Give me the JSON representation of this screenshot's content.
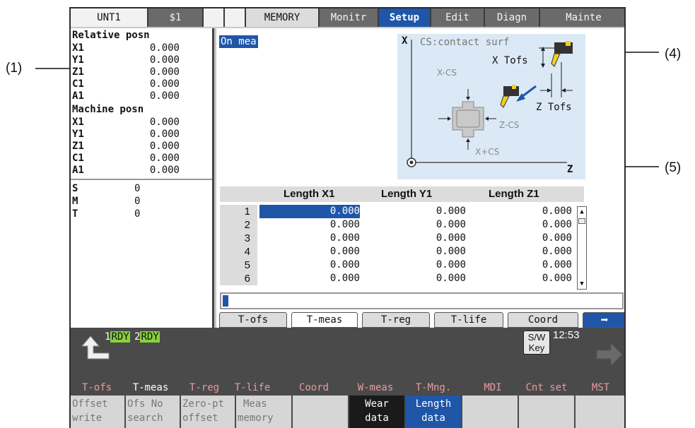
{
  "callouts": [
    "(1)",
    "(4)",
    "(5)"
  ],
  "topbar": {
    "unit": "UNT1",
    "system": "$1",
    "mode": "MEMORY",
    "tabs": [
      "Monitr",
      "Setup",
      "Edit",
      "Diagn",
      "Mainte"
    ],
    "active_tab": "Setup"
  },
  "left": {
    "relative_title": "Relative posn",
    "relative": [
      {
        "axis": "X1",
        "value": "0.000"
      },
      {
        "axis": "Y1",
        "value": "0.000"
      },
      {
        "axis": "Z1",
        "value": "0.000"
      },
      {
        "axis": "C1",
        "value": "0.000"
      },
      {
        "axis": "A1",
        "value": "0.000"
      }
    ],
    "machine_title": "Machine posn",
    "machine": [
      {
        "axis": "X1",
        "value": "0.000"
      },
      {
        "axis": "Y1",
        "value": "0.000"
      },
      {
        "axis": "Z1",
        "value": "0.000"
      },
      {
        "axis": "C1",
        "value": "0.000"
      },
      {
        "axis": "A1",
        "value": "0.000"
      }
    ],
    "smt": [
      {
        "label": "S",
        "value": "0"
      },
      {
        "label": "M",
        "value": "0"
      },
      {
        "label": "T",
        "value": "0"
      }
    ]
  },
  "main": {
    "status": "On mea",
    "diagram": {
      "x_axis": "X",
      "z_axis": "Z",
      "cs_label": "CS:contact surf",
      "x_tofs": "X Tofs",
      "z_tofs": "Z Tofs",
      "x_minus_cs": "X-CS",
      "z_minus_cs": "Z-CS",
      "x_plus_cs": "X+CS"
    },
    "table": {
      "headers": [
        "Length X1",
        "Length Y1",
        "Length Z1"
      ],
      "rows": [
        {
          "no": "1",
          "x": "0.000",
          "y": "0.000",
          "z": "0.000"
        },
        {
          "no": "2",
          "x": "0.000",
          "y": "0.000",
          "z": "0.000"
        },
        {
          "no": "3",
          "x": "0.000",
          "y": "0.000",
          "z": "0.000"
        },
        {
          "no": "4",
          "x": "0.000",
          "y": "0.000",
          "z": "0.000"
        },
        {
          "no": "5",
          "x": "0.000",
          "y": "0.000",
          "z": "0.000"
        },
        {
          "no": "6",
          "x": "0.000",
          "y": "0.000",
          "z": "0.000"
        }
      ]
    },
    "input_value": "",
    "tabs": [
      "T-ofs",
      "T-meas",
      "T-reg",
      "T-life",
      "Coord"
    ],
    "active_tab": "T-meas",
    "next_arrow": "➡"
  },
  "bottom": {
    "rdy": [
      {
        "n": "1",
        "t": "RDY"
      },
      {
        "n": "2",
        "t": "RDY"
      }
    ],
    "swkey": [
      "S/W",
      "Key"
    ],
    "clock": "12:53",
    "menu": [
      "T-ofs",
      "T-meas",
      "T-reg",
      "T-life",
      "Coord",
      "W-meas",
      "T-Mng.",
      "MDI",
      "Cnt set",
      "MST"
    ],
    "fkeys": [
      [
        "Offset",
        "write"
      ],
      [
        "Ofs No",
        "search"
      ],
      [
        "Zero-pt",
        "offset"
      ],
      [
        "Meas",
        "memory"
      ],
      [
        "",
        ""
      ],
      [
        "Wear",
        "data"
      ],
      [
        "Length",
        "data"
      ],
      [
        "",
        ""
      ],
      [
        "",
        ""
      ],
      [
        "",
        ""
      ]
    ]
  },
  "colors": {
    "accent_blue": "#1f56a8",
    "rdy_green": "#86d23c",
    "menu_dim": "#e89aa0",
    "diagram_bg": "#dbe8f5"
  }
}
